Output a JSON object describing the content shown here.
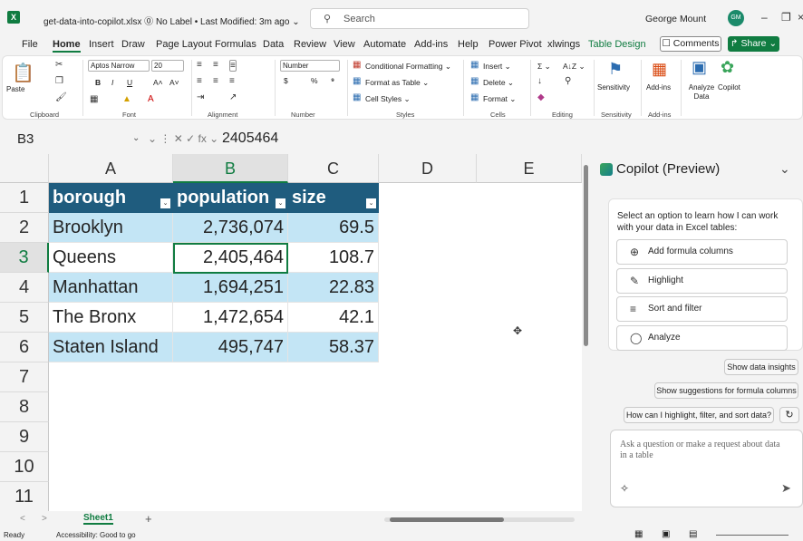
{
  "titlebar": {
    "app_icon": "excel-icon",
    "file_title": "get-data-into-copilot.xlsx  ⓪ No Label • Last Modified: 3m ago ⌄",
    "search_placeholder": "Search",
    "user_name": "George Mount",
    "user_initials": "GM",
    "minimize": "–",
    "restore": "❐",
    "close": "×"
  },
  "tabs": {
    "items": [
      "File",
      "Home",
      "Insert",
      "Draw",
      "Page Layout",
      "Formulas",
      "Data",
      "Review",
      "View",
      "Automate",
      "Add-ins",
      "Help",
      "Power Pivot",
      "xlwings",
      "Table Design"
    ],
    "active": "Home",
    "comments": "☐ Comments",
    "share": "↱ Share ⌄"
  },
  "ribbon": {
    "clipboard": {
      "paste": "Paste",
      "label": "Clipboard"
    },
    "font": {
      "name": "Aptos Narrow",
      "size": "20",
      "bold": "B",
      "italic": "I",
      "underline": "U",
      "grow": "A˄",
      "shrink": "A˅",
      "label": "Font"
    },
    "alignment": {
      "label": "Alignment"
    },
    "number": {
      "format": "Number",
      "currency": "$",
      "percent": "%",
      "comma": "⁹",
      "label": "Number"
    },
    "styles": {
      "conditional": "Conditional Formatting ⌄",
      "format_table": "Format as Table ⌄",
      "cell_styles": "Cell Styles ⌄",
      "label": "Styles"
    },
    "cells": {
      "insert": "Insert ⌄",
      "delete": "Delete ⌄",
      "format": "Format ⌄",
      "label": "Cells"
    },
    "editing": {
      "sum": "Σ ⌄",
      "sort": "A↓Z ⌄",
      "label": "Editing"
    },
    "sensitivity": {
      "button": "Sensitivity",
      "label": "Sensitivity"
    },
    "addins": {
      "button": "Add-ins",
      "label": "Add-ins"
    },
    "analyze": {
      "button": "Analyze Data"
    },
    "copilot": {
      "button": "Copilot"
    }
  },
  "formula_bar": {
    "name_box": "B3",
    "fx": "⌄  ⋮  ✕  ✓  fx ⌄",
    "value": "2405464"
  },
  "sheet": {
    "columns": [
      "A",
      "B",
      "C",
      "D",
      "E"
    ],
    "rows": [
      "1",
      "2",
      "3",
      "4",
      "5",
      "6",
      "7",
      "8",
      "9",
      "10",
      "11"
    ],
    "headers": [
      "borough",
      "population",
      "size"
    ],
    "data": [
      [
        "Brooklyn",
        "2,736,074",
        "69.5"
      ],
      [
        "Queens",
        "2,405,464",
        "108.7"
      ],
      [
        "Manhattan",
        "1,694,251",
        "22.83"
      ],
      [
        "The Bronx",
        "1,472,654",
        "42.1"
      ],
      [
        "Staten Island",
        "495,747",
        "58.37"
      ]
    ],
    "filter_glyph": "⌄"
  },
  "sheet_tabs": {
    "nav_prev": "<",
    "nav_next": ">",
    "active": "Sheet1",
    "add": "+"
  },
  "status": {
    "ready": "Ready",
    "accessibility": "Accessibility: Good to go"
  },
  "copilot": {
    "title": "Copilot (Preview)",
    "collapse": "⌄",
    "intro": "Select an option to learn how I can work with your data in Excel tables:",
    "options": [
      {
        "icon": "⊕",
        "label": "Add formula columns"
      },
      {
        "icon": "✎",
        "label": "Highlight"
      },
      {
        "icon": "≡",
        "label": "Sort and filter"
      },
      {
        "icon": "◯",
        "label": "Analyze"
      }
    ],
    "suggestions": [
      "Show data insights",
      "Show suggestions for formula columns",
      "How can I highlight, filter, and sort data?"
    ],
    "refresh": "↻",
    "input_placeholder": "Ask a question or make a request about data in a table",
    "send": "➤",
    "sparkle": "✧"
  }
}
